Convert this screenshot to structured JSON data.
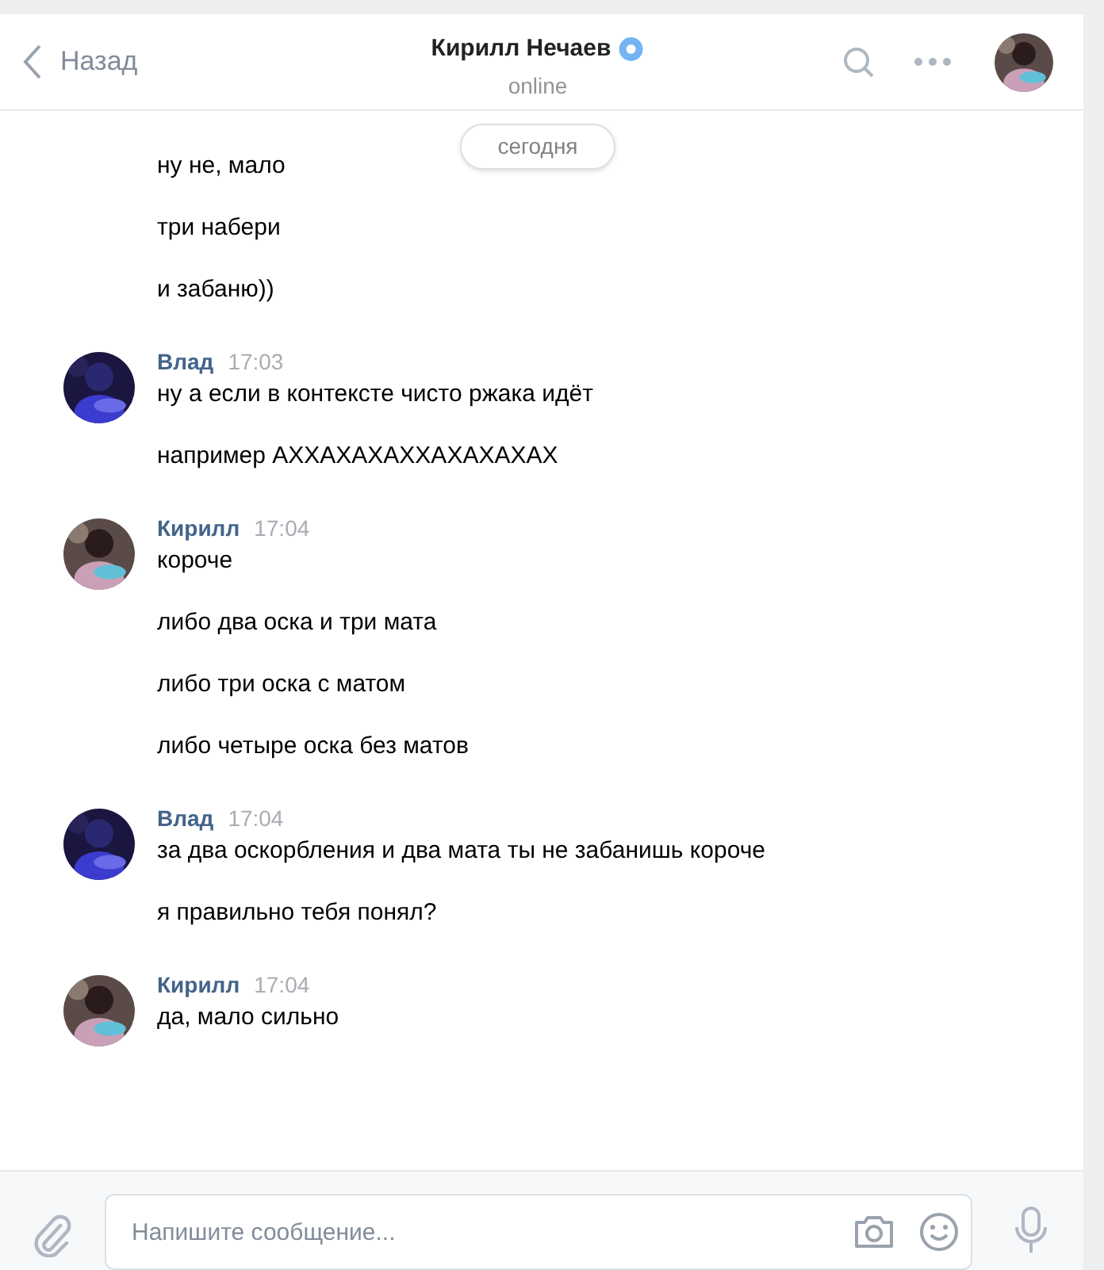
{
  "header": {
    "back_label": "Назад",
    "title": "Кирилл Нечаев",
    "verified": true,
    "status": "online",
    "avatar": {
      "kind": "picture"
    }
  },
  "date_badge": "сегодня",
  "groups": [
    {
      "lines": [
        "ну не, мало",
        "три набери",
        "и забаню))"
      ]
    },
    {
      "author": "Влад",
      "time": "17:03",
      "avatar": {
        "kind": "picture"
      },
      "lines": [
        "ну а если в контексте чисто ржака идёт",
        "например АХХАХАХАХХАХАХАХАХ"
      ]
    },
    {
      "author": "Кирилл",
      "time": "17:04",
      "avatar": {
        "kind": "picture"
      },
      "lines": [
        "короче",
        "либо два оска и три мата",
        "либо три оска с матом",
        "либо четыре оска без матов"
      ]
    },
    {
      "author": "Влад",
      "time": "17:04",
      "avatar": {
        "kind": "picture"
      },
      "lines": [
        "за два оскорбления и два мата ты не забанишь короче",
        "я правильно тебя понял?"
      ]
    },
    {
      "author": "Кирилл",
      "time": "17:04",
      "avatar": {
        "kind": "picture"
      },
      "lines": [
        "да, мало сильно"
      ]
    }
  ],
  "composer": {
    "placeholder": "Напишите сообщение..."
  }
}
